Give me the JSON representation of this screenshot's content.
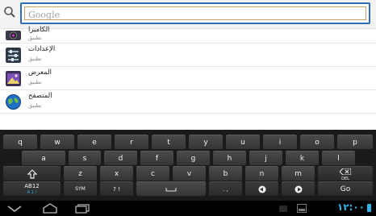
{
  "search": {
    "placeholder": "Google",
    "value": ""
  },
  "results": [
    {
      "name": "الكاميرا",
      "sub": "تطبيق",
      "icon": "camera-icon"
    },
    {
      "name": "الإعدادات",
      "sub": "تطبيق",
      "icon": "settings-icon"
    },
    {
      "name": "المعرض",
      "sub": "تطبيق",
      "icon": "gallery-icon"
    },
    {
      "name": "المتصفح",
      "sub": "تطبيق",
      "icon": "browser-icon"
    }
  ],
  "keyboard": {
    "row1": [
      "q",
      "w",
      "e",
      "r",
      "t",
      "y",
      "u",
      "i",
      "o",
      "p"
    ],
    "row2": [
      "a",
      "s",
      "d",
      "f",
      "g",
      "h",
      "j",
      "k",
      "l"
    ],
    "row3": [
      "z",
      "x",
      "c",
      "v",
      "b",
      "n",
      "m"
    ],
    "del_label": "DEL",
    "abc_label": "AB12",
    "abc_sub": "A 1 !",
    "sym_label": "SYM",
    "punct_label": "? !",
    "comma_label": ". ,",
    "go_label": "Go"
  },
  "status": {
    "time": "١٢:٠٠"
  }
}
